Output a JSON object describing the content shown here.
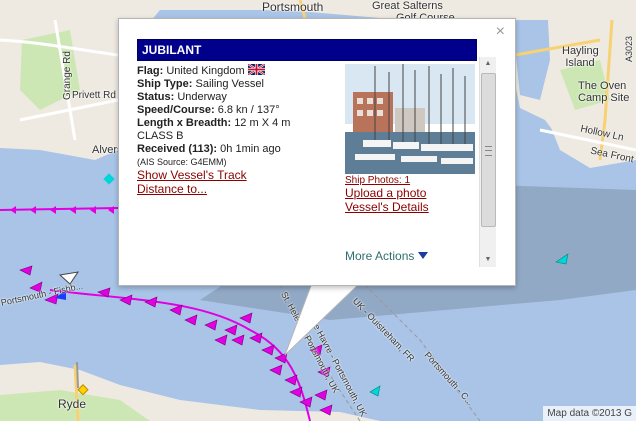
{
  "map": {
    "labels": {
      "portsmouth": "Portsmouth",
      "great_salterns": "Great Salterns",
      "golf_course": "Golf Course",
      "hayling_island": "Hayling Island",
      "oven_camp": "The Oven Camp Site",
      "hollow_ln": "Hollow Ln",
      "sea_front": "Sea Front",
      "alverstoke": "Alvers",
      "grange_rd": "Grange Rd",
      "privett_rd": "Privett Rd",
      "ryde": "Ryde",
      "a3023": "A3023",
      "fishbourne": "Portsmouth - Fishb...",
      "st_helens": "St. Helens - Portsmouth, UK",
      "le_havre": "Le Havre - Portsmouth, UK",
      "ouistreham": "UK - Ouistreham, FR",
      "portsmouth_c": "Portsmouth - C..."
    },
    "attribution": "Map data ©2013 G"
  },
  "popup": {
    "title": "JUBILANT",
    "flag_label": "Flag:",
    "flag_value": "United Kingdom",
    "ship_type_label": "Ship Type:",
    "ship_type_value": "Sailing Vessel",
    "status_label": "Status:",
    "status_value": "Underway",
    "speed_label": "Speed/Course:",
    "speed_value": "6.8 kn / 137°",
    "length_label": "Length x Breadth:",
    "length_value": "12 m X 4 m",
    "class": "CLASS B",
    "received_label": "Received (113):",
    "received_value": "0h 1min ago",
    "ais_source": "(AIS Source: G4EMM)",
    "show_track": "Show Vessel's Track",
    "distance_to": "Distance to...",
    "ship_photos": "Ship Photos: 1",
    "upload_photo": "Upload a photo",
    "vessel_details": "Vessel's Details",
    "more_actions": "More Actions",
    "close_glyph": "×"
  },
  "colors": {
    "title_bg": "#00008b",
    "link": "#8b0000",
    "vessel_magenta": "#e100e1",
    "water": "#a9c4e7",
    "land": "#eeeae2"
  }
}
